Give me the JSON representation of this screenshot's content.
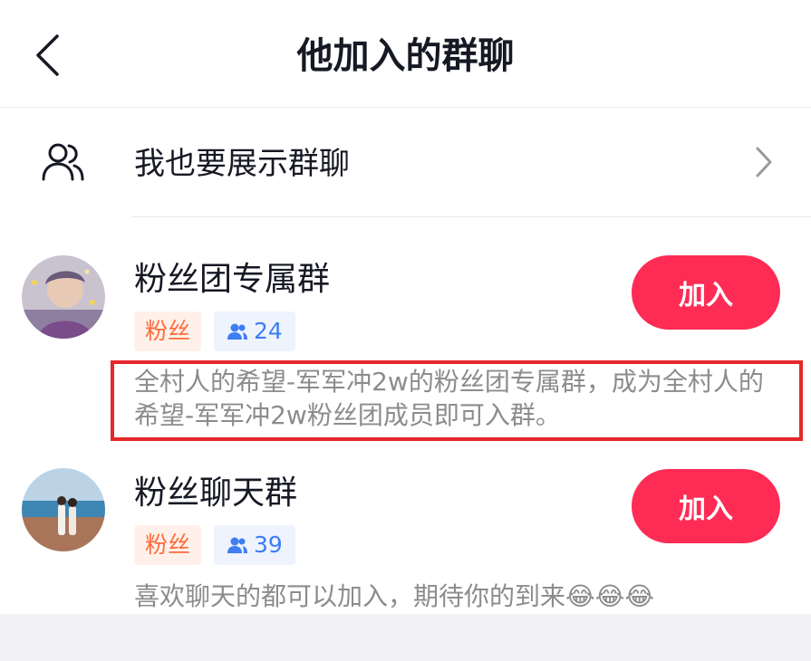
{
  "header": {
    "title": "他加入的群聊",
    "back_icon": "chevron-left-icon"
  },
  "show_groups": {
    "label": "我也要展示群聊",
    "icon": "users-icon",
    "chevron_icon": "chevron-right-icon"
  },
  "groups": [
    {
      "name": "粉丝团专属群",
      "tag": "粉丝",
      "member_count": "24",
      "description": "全村人的希望-军军冲2w的粉丝团专属群，成为全村人的希望-军军冲2w粉丝团成员即可入群。",
      "join_label": "加入"
    },
    {
      "name": "粉丝聊天群",
      "tag": "粉丝",
      "member_count": "39",
      "description": "喜欢聊天的都可以加入，期待你的到来😂😂😂",
      "join_label": "加入"
    }
  ],
  "colors": {
    "accent": "#fe2c55",
    "fan_tag_text": "#fe6a3a",
    "fan_tag_bg": "#fff1ea",
    "count_tag_text": "#3d7ef2",
    "count_tag_bg": "#eef3fe",
    "highlight_border": "#e5282b"
  }
}
